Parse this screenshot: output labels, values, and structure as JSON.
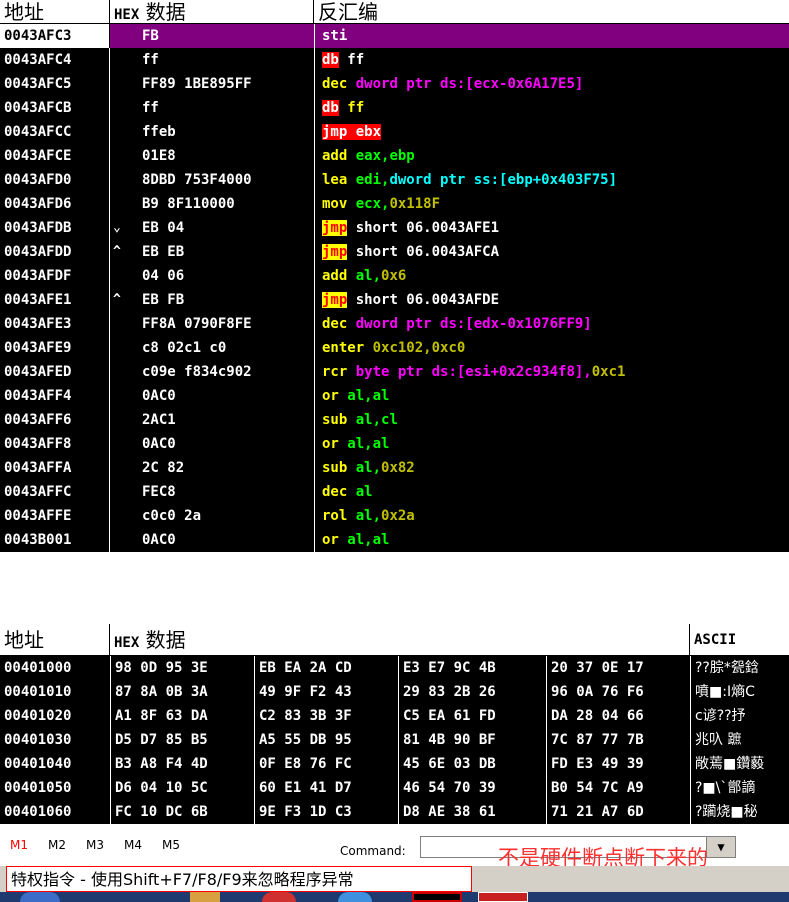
{
  "disasm": {
    "headers": {
      "address": "地址",
      "hex": "HEX 数据",
      "disasm": "反汇编"
    },
    "rows": [
      {
        "addr": "0043AFC3",
        "hex": "FB",
        "selected": true,
        "asm": [
          {
            "t": "sti",
            "c": "white"
          }
        ]
      },
      {
        "addr": "0043AFC4",
        "hex": "ff",
        "asm": [
          {
            "t": "db",
            "c": "red-bg"
          },
          {
            "t": " ff",
            "c": "white"
          }
        ]
      },
      {
        "addr": "0043AFC5",
        "hex": "FF89 1BE895FF",
        "asm": [
          {
            "t": "dec",
            "c": "yellow"
          },
          {
            "t": " dword ptr ds:[ecx-0x6A17E5]",
            "c": "magenta"
          }
        ]
      },
      {
        "addr": "0043AFCB",
        "hex": "ff",
        "asm": [
          {
            "t": "db",
            "c": "red-bg"
          },
          {
            "t": " ff",
            "c": "yellow"
          }
        ]
      },
      {
        "addr": "0043AFCC",
        "hex": "ffeb",
        "asm": [
          {
            "t": "jmp ebx",
            "c": "red-bg"
          }
        ]
      },
      {
        "addr": "0043AFCE",
        "hex": "01E8",
        "asm": [
          {
            "t": "add",
            "c": "yellow"
          },
          {
            "t": " eax,ebp",
            "c": "green"
          }
        ]
      },
      {
        "addr": "0043AFD0",
        "hex": "8DBD 753F4000",
        "asm": [
          {
            "t": "lea",
            "c": "yellow"
          },
          {
            "t": " edi,",
            "c": "green"
          },
          {
            "t": "dword ptr ss:[ebp+0x403F75]",
            "c": "cyan"
          }
        ]
      },
      {
        "addr": "0043AFD6",
        "hex": "B9 8F110000",
        "asm": [
          {
            "t": "mov",
            "c": "yellow"
          },
          {
            "t": " ecx,",
            "c": "green"
          },
          {
            "t": "0x118F",
            "c": "olive"
          }
        ]
      },
      {
        "addr": "0043AFDB",
        "mark": "⌄",
        "hex": "EB 04",
        "asm": [
          {
            "t": "jmp",
            "c": "yellow-bg"
          },
          {
            "t": " short 06.0043AFE1",
            "c": "white"
          }
        ]
      },
      {
        "addr": "0043AFDD",
        "mark": "^",
        "hex": "EB EB",
        "asm": [
          {
            "t": "jmp",
            "c": "yellow-bg"
          },
          {
            "t": " short 06.0043AFCA",
            "c": "white"
          }
        ]
      },
      {
        "addr": "0043AFDF",
        "hex": "04 06",
        "asm": [
          {
            "t": "add",
            "c": "yellow"
          },
          {
            "t": " al,",
            "c": "green"
          },
          {
            "t": "0x6",
            "c": "olive"
          }
        ]
      },
      {
        "addr": "0043AFE1",
        "mark": "^",
        "hex": "EB FB",
        "asm": [
          {
            "t": "jmp",
            "c": "yellow-bg"
          },
          {
            "t": " short 06.0043AFDE",
            "c": "white"
          }
        ]
      },
      {
        "addr": "0043AFE3",
        "hex": "FF8A 0790F8FE",
        "asm": [
          {
            "t": "dec",
            "c": "yellow"
          },
          {
            "t": " dword ptr ds:[edx-0x1076FF9]",
            "c": "magenta"
          }
        ]
      },
      {
        "addr": "0043AFE9",
        "hex": "c8 02c1 c0",
        "asm": [
          {
            "t": "enter",
            "c": "yellow"
          },
          {
            "t": " 0xc102,0xc0",
            "c": "olive"
          }
        ]
      },
      {
        "addr": "0043AFED",
        "hex": "c09e f834c902",
        "asm": [
          {
            "t": "rcr",
            "c": "yellow"
          },
          {
            "t": " byte ptr ds:[esi+0x2c934f8],",
            "c": "magenta"
          },
          {
            "t": "0xc1",
            "c": "olive"
          }
        ]
      },
      {
        "addr": "0043AFF4",
        "hex": "0AC0",
        "asm": [
          {
            "t": "or",
            "c": "yellow"
          },
          {
            "t": " al,al",
            "c": "green"
          }
        ]
      },
      {
        "addr": "0043AFF6",
        "hex": "2AC1",
        "asm": [
          {
            "t": "sub",
            "c": "yellow"
          },
          {
            "t": " al,cl",
            "c": "green"
          }
        ]
      },
      {
        "addr": "0043AFF8",
        "hex": "0AC0",
        "asm": [
          {
            "t": "or",
            "c": "yellow"
          },
          {
            "t": " al,al",
            "c": "green"
          }
        ]
      },
      {
        "addr": "0043AFFA",
        "hex": "2C 82",
        "asm": [
          {
            "t": "sub",
            "c": "yellow"
          },
          {
            "t": " al,",
            "c": "green"
          },
          {
            "t": "0x82",
            "c": "olive"
          }
        ]
      },
      {
        "addr": "0043AFFC",
        "hex": "FEC8",
        "asm": [
          {
            "t": "dec",
            "c": "yellow"
          },
          {
            "t": " al",
            "c": "green"
          }
        ]
      },
      {
        "addr": "0043AFFE",
        "hex": "c0c0 2a",
        "asm": [
          {
            "t": "rol",
            "c": "yellow"
          },
          {
            "t": " al,",
            "c": "green"
          },
          {
            "t": "0x2a",
            "c": "olive"
          }
        ]
      },
      {
        "addr": "0043B001",
        "hex": "0AC0",
        "asm": [
          {
            "t": "or",
            "c": "yellow"
          },
          {
            "t": " al,al",
            "c": "green"
          }
        ]
      }
    ]
  },
  "dump": {
    "headers": {
      "address": "地址",
      "hex": "HEX 数据",
      "ascii": "ASCII"
    },
    "rows": [
      {
        "addr": "00401000",
        "groups": [
          "98 0D 95 3E",
          "EB EA 2A CD",
          "E3 E7 9C 4B",
          "20 37 0E 17"
        ],
        "ascii": "??腙*㼝鋡"
      },
      {
        "addr": "00401010",
        "groups": [
          "87 8A 0B 3A",
          "49 9F F2 43",
          "29 83 2B 26",
          "96 0A 76 F6"
        ],
        "ascii": "噴■:I熵C"
      },
      {
        "addr": "00401020",
        "groups": [
          "A1 8F 63 DA",
          "C2 83 3B 3F",
          "C5 EA 61 FD",
          "DA 28 04 66"
        ],
        "ascii": "  c谚??抒"
      },
      {
        "addr": "00401030",
        "groups": [
          "D5 D7 85 B5",
          "A5 55 DB 95",
          "81 4B 90 BF",
          "7C 87 77 7B"
        ],
        "ascii": "兆叺  蹠"
      },
      {
        "addr": "00401040",
        "groups": [
          "B3 A8 F4 4D",
          "0F E8 76 FC",
          "45 6E 03 DB",
          "FD E3 49 39"
        ],
        "ascii": "敞蔫■鑽藙"
      },
      {
        "addr": "00401050",
        "groups": [
          "D6 04 10 5C",
          "60 E1 41 D7",
          "46 54 70 39",
          "B0 54 7C A9"
        ],
        "ascii": "?■\\`鄫謫"
      },
      {
        "addr": "00401060",
        "groups": [
          "FC 10 DC 6B",
          "9E F3 1D C3",
          "D8 AE 38 61",
          "71 21 A7 6D"
        ],
        "ascii": "?躏烧■秘"
      }
    ]
  },
  "bottom": {
    "tabs": [
      "M1",
      "M2",
      "M3",
      "M4",
      "M5"
    ],
    "active_tab": "M1",
    "command_label": "Command:",
    "dropdown_glyph": "▼",
    "annotation": "不是硬件断点断下来的"
  },
  "status": {
    "text": "特权指令 - 使用Shift+F7/F8/F9来忽略程序异常"
  },
  "colors": {
    "white": "#ffffff",
    "yellow": "#ffff00",
    "green": "#00ff00",
    "magenta": "#ff00ff",
    "olive": "#c0c000",
    "cyan": "#00ffff",
    "selection": "#800080",
    "red": "#ff0000"
  }
}
